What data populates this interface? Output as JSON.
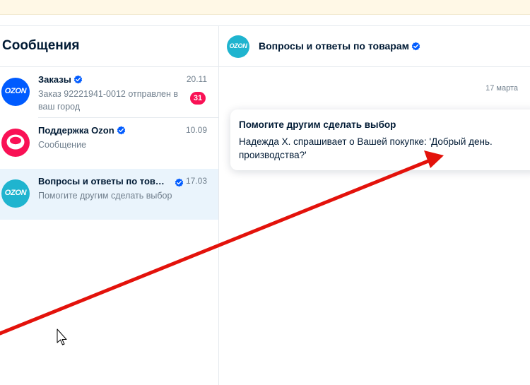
{
  "messages_panel": {
    "title": "Сообщения",
    "chats": [
      {
        "name": "Заказы",
        "date": "20.11",
        "preview": "Заказ 92221941-0012 отправлен в ваш город",
        "badge": "31",
        "avatar_text": "OZON",
        "avatar_color": "#005bff"
      },
      {
        "name": "Поддержка Ozon",
        "date": "10.09",
        "preview": "Сообщение",
        "avatar_color": "#f91155"
      },
      {
        "name": "Вопросы и ответы по товарам",
        "date": "17.03",
        "preview": "Помогите другим сделать выбор",
        "avatar_text": "OZON",
        "avatar_color": "#1fb4cf"
      }
    ]
  },
  "chat_view": {
    "header_title": "Вопросы и ответы по товарам",
    "avatar_text": "OZON",
    "date_separator": "17 марта",
    "message": {
      "title": "Помогите другим сделать выбор",
      "body": "Надежда Х. спрашивает о Вашей покупке: 'Добрый день. производства?'"
    }
  },
  "colors": {
    "verified": "#005bff",
    "badge": "#f91155",
    "active_chat": "#eaf4fc",
    "annotation_arrow": "#e3120b"
  }
}
